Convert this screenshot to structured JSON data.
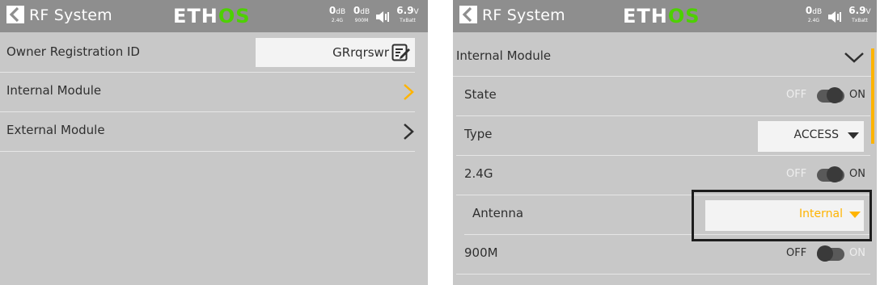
{
  "left": {
    "header": {
      "title": "RF System",
      "logo_main": "ETH",
      "logo_accent": "OS",
      "status": {
        "db1": "0",
        "db1_unit": "dB",
        "db1_sub": "2.4G",
        "db2": "0",
        "db2_unit": "dB",
        "db2_sub": "900M",
        "volt": "6.9",
        "volt_unit": "V",
        "volt_sub": "TxBatt"
      }
    },
    "rows": {
      "owner_label": "Owner Registration ID",
      "owner_value": "GRrqrswr",
      "internal_label": "Internal Module",
      "external_label": "External Module"
    }
  },
  "right": {
    "header": {
      "title": "RF System",
      "logo_main": "ETH",
      "logo_accent": "OS",
      "status": {
        "db1": "0",
        "db1_unit": "dB",
        "db1_sub": "2.4G",
        "volt": "6.9",
        "volt_unit": "V",
        "volt_sub": "TxBatt"
      }
    },
    "rows": {
      "internal_label": "Internal Module",
      "state_label": "State",
      "type_label": "Type",
      "type_value": "ACCESS",
      "g24_label": "2.4G",
      "antenna_label": "Antenna",
      "antenna_value": "Internal",
      "m900_label": "900M"
    },
    "toggle": {
      "off": "OFF",
      "on": "ON"
    }
  },
  "colors": {
    "accent": "#ffb400",
    "logo_green": "#4dd000",
    "panel_bg": "#c8c8c8",
    "header_bg": "#8e8e8e"
  }
}
